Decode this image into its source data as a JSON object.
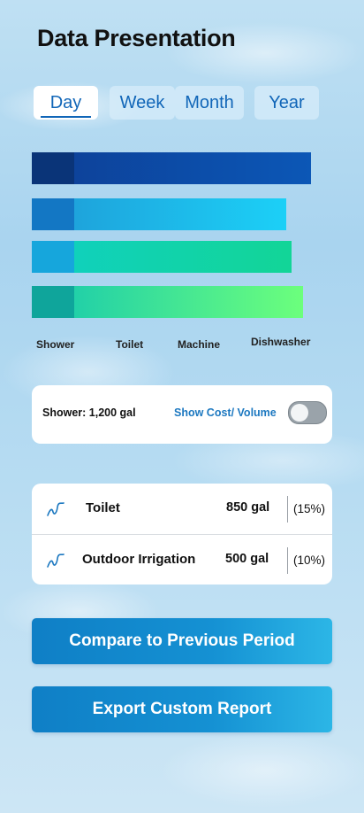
{
  "header": {
    "title": "Data Presentation"
  },
  "tabs": [
    {
      "label": "Day",
      "active": true
    },
    {
      "label": "Week",
      "active": false
    },
    {
      "label": "Month",
      "active": false
    },
    {
      "label": "Year",
      "active": false
    }
  ],
  "chart_data": {
    "type": "bar",
    "categories": [
      "Shower",
      "Toilet",
      "Machine",
      "Dishwasher"
    ],
    "values": [
      100,
      91,
      93,
      97
    ],
    "colors": [
      {
        "start": "#0d3f96",
        "end": "#0c57b6",
        "accent": "#0a3478"
      },
      {
        "start": "#1f9bd6",
        "end": "#1cd0f7",
        "accent": "#1377c4"
      },
      {
        "start": "#10d0c2",
        "end": "#12d597",
        "accent": "#16a6dc"
      },
      {
        "start": "#14c8b0",
        "end": "#6cff7c",
        "accent": "#0fa59b"
      }
    ]
  },
  "summary": {
    "text": "Shower: 1,200 gal",
    "toggle_label": "Show Cost/ Volume",
    "toggle_on": false
  },
  "usage_list": [
    {
      "icon": "trend-line-icon",
      "name": "Toilet",
      "gallons": "850 gal",
      "percent": "(15%)"
    },
    {
      "icon": "trend-line-icon",
      "name": "Outdoor Irrigation",
      "gallons": "500 gal",
      "percent": "(10%)"
    }
  ],
  "actions": {
    "compare_label": "Compare to Previous Period",
    "export_label": "Export Custom Report"
  }
}
